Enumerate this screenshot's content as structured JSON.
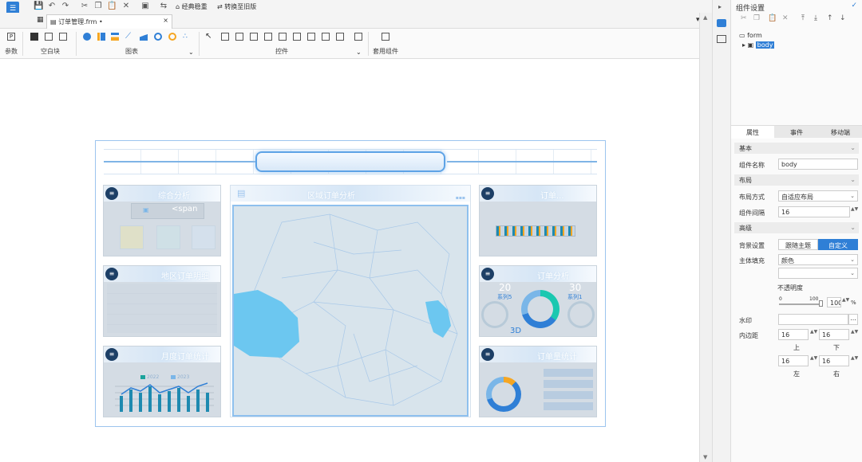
{
  "app": {
    "tab_label": "订单管理.frm",
    "tab_modified": "•",
    "tab_close": "×"
  },
  "quickbar": {
    "classic_label": "经典稳重",
    "convert_label": "转换至旧版"
  },
  "ribbon": {
    "groups": {
      "param": "参数",
      "blank": "空白块",
      "chart": "图表",
      "controls": "控件",
      "template": "套用组件"
    },
    "expand": "⌄"
  },
  "dashboard": {
    "header_title": "",
    "panels": [
      {
        "title": "综合分析"
      },
      {
        "title": "区域订单分析"
      },
      {
        "title": "订单..."
      },
      {
        "title": "地区订单明细"
      },
      {
        "title": "订单分析"
      },
      {
        "title": "月度订单统计"
      },
      {
        "title": "订单量统计"
      }
    ],
    "span_label": "<span",
    "donut": {
      "left_value": "20",
      "left_series": "系列5",
      "right_value": "30",
      "right_series": "系列1",
      "bottom_value": "3D"
    },
    "legend": [
      "2022",
      "2023"
    ]
  },
  "right_panel": {
    "title": "组件设置",
    "tree": {
      "root": "form",
      "child": "body"
    },
    "tabs": [
      "属性",
      "事件",
      "移动端"
    ],
    "sections": {
      "basic": "基本",
      "layout": "布局",
      "advanced": "高级"
    },
    "fields": {
      "name_label": "组件名称",
      "name_value": "body",
      "layout_label": "布局方式",
      "layout_value": "自适应布局",
      "gap_label": "组件间隔",
      "gap_value": "16",
      "bg_label": "背景设置",
      "bg_follow": "跟随主题",
      "bg_custom": "自定义",
      "fill_label": "主体填充",
      "fill_value": "颜色",
      "opacity_label": "不透明度",
      "opacity_min": "0",
      "opacity_max": "100",
      "opacity_value": "100",
      "opacity_unit": "%",
      "watermark_label": "水印",
      "watermark_btn": "...",
      "padding_label": "内边距",
      "pad_top": "16",
      "pad_bottom": "16",
      "pad_left": "16",
      "pad_right": "16",
      "pad_top_label": "上",
      "pad_bottom_label": "下",
      "pad_left_label": "左",
      "pad_right_label": "右"
    }
  },
  "colors": {
    "accent": "#2f7fd6",
    "panel": "#d4dce4",
    "map": "#d8e4ec",
    "water": "#6cc7f0"
  }
}
